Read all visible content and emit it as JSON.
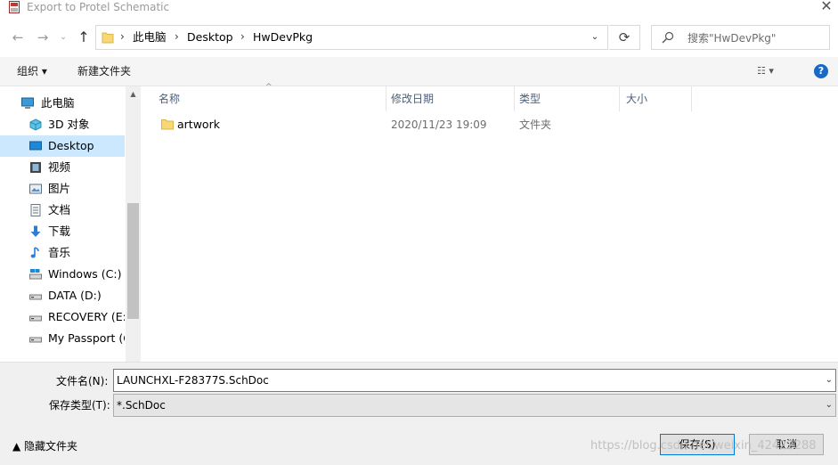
{
  "window": {
    "title": "Export to Protel Schematic",
    "close_glyph": "✕"
  },
  "nav": {
    "back_glyph": "←",
    "forward_glyph": "→",
    "recent_glyph": "⌄",
    "up_glyph": "↑",
    "breadcrumb": [
      "此电脑",
      "Desktop",
      "HwDevPkg"
    ],
    "separator": "›",
    "dropdown_glyph": "⌄",
    "refresh_glyph": "⟳",
    "search_placeholder": "搜索\"HwDevPkg\""
  },
  "toolbar": {
    "organize": "组织 ▾",
    "new_folder": "新建文件夹",
    "view_glyph": "☷ ▾",
    "help_glyph": "?"
  },
  "sidebar": {
    "items": [
      {
        "label": "此电脑",
        "icon": "computer-icon",
        "selected": false
      },
      {
        "label": "3D 对象",
        "icon": "3d-objects-icon",
        "selected": false
      },
      {
        "label": "Desktop",
        "icon": "desktop-icon",
        "selected": true
      },
      {
        "label": "视频",
        "icon": "video-icon",
        "selected": false
      },
      {
        "label": "图片",
        "icon": "picture-icon",
        "selected": false
      },
      {
        "label": "文档",
        "icon": "document-icon",
        "selected": false
      },
      {
        "label": "下载",
        "icon": "download-icon",
        "selected": false
      },
      {
        "label": "音乐",
        "icon": "music-icon",
        "selected": false
      },
      {
        "label": "Windows (C:)",
        "icon": "drive-icon",
        "selected": false
      },
      {
        "label": "DATA (D:)",
        "icon": "drive-icon",
        "selected": false
      },
      {
        "label": "RECOVERY (E:)",
        "icon": "drive-icon",
        "selected": false
      },
      {
        "label": "My Passport (G",
        "icon": "drive-icon",
        "selected": false
      }
    ],
    "scroll_up_glyph": "▲"
  },
  "columns": {
    "name": "名称",
    "modified": "修改日期",
    "type": "类型",
    "size": "大小",
    "sort_glyph": "^"
  },
  "files": [
    {
      "name": "artwork",
      "modified": "2020/11/23 19:09",
      "type": "文件夹",
      "size": ""
    }
  ],
  "form": {
    "filename_label": "文件名(N):",
    "filename_value": "LAUNCHXL-F28377S.SchDoc",
    "filetype_label": "保存类型(T):",
    "filetype_value": "*.SchDoc",
    "dropdown_glyph": "⌄"
  },
  "footer": {
    "hide_folders": "▲  隐藏文件夹",
    "save": "保存(S)",
    "cancel": "取消",
    "watermark": "https://blog.csdn.net/weixin_42422288"
  },
  "colors": {
    "selected_bg": "#cce8ff",
    "folder_yellow": "#f8d775",
    "accent_blue": "#0078d7"
  }
}
